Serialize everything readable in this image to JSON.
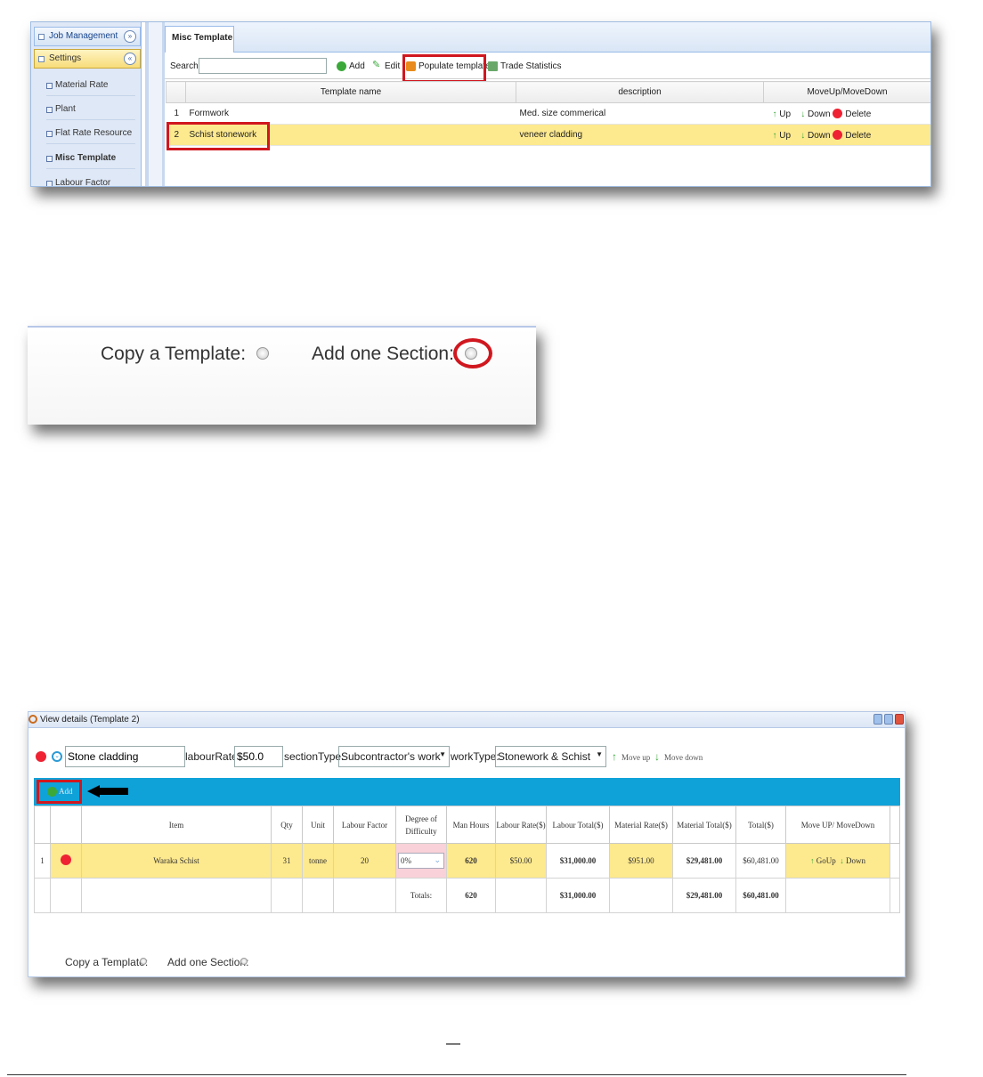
{
  "sidebar": {
    "job_management": "Job Management",
    "settings": "Settings",
    "items": [
      "Material Rate",
      "Plant",
      "Flat Rate Resource",
      "Misc Template",
      "Labour Factor"
    ]
  },
  "tab": {
    "label": "Misc Template"
  },
  "toolbar": {
    "search_label": "Search:",
    "search_value": "",
    "add": "Add",
    "edit": "Edit",
    "populate": "Populate template",
    "trade_stats": "Trade Statistics"
  },
  "grid1": {
    "headers": [
      "Template name",
      "description",
      "MoveUp/MoveDown"
    ],
    "rows": [
      {
        "num": "1",
        "name": "Formwork",
        "desc": "Med. size commerical",
        "up": "Up",
        "down": "Down",
        "del": "Delete"
      },
      {
        "num": "2",
        "name": "Schist stonework",
        "desc": "veneer cladding",
        "up": "Up",
        "down": "Down",
        "del": "Delete"
      }
    ]
  },
  "copy_big": "Copy a Template:",
  "add_big": "Add one Section:",
  "view": {
    "title": "View details (Template 2)",
    "section_name": "Stone cladding",
    "labour_label": "labourRate:",
    "labour_value": "$50.0",
    "section_type_label": "sectionType:",
    "section_type_value": "Subcontractor's work",
    "work_type_label": "workType:",
    "work_type_value": "Stonework & Schist",
    "move_up": "Move up",
    "move_down": "Move down",
    "add": "Add"
  },
  "grid3": {
    "headers": [
      "Item",
      "Qty",
      "Unit",
      "Labour Factor",
      "Degree of Difficulty",
      "Man Hours",
      "Labour Rate($)",
      "Labour Total($)",
      "Material Rate($)",
      "Material Total($)",
      "Total($)",
      "Move UP/ MoveDown"
    ],
    "row": {
      "num": "1",
      "item": "Waraka Schist",
      "qty": "31",
      "unit": "tonne",
      "factor": "20",
      "difficulty": "0%",
      "man_hours": "620",
      "labour_rate": "$50.00",
      "labour_total": "$31,000.00",
      "material_rate": "$951.00",
      "material_total": "$29,481.00",
      "total": "$60,481.00",
      "goup": "GoUp",
      "down": "Down"
    },
    "totals": {
      "label": "Totals:",
      "man_hours": "620",
      "labour_total": "$31,000.00",
      "material_total": "$29,481.00",
      "total": "$60,481.00"
    }
  },
  "copy_small": "Copy a Template:",
  "add_small": "Add one Section:",
  "footer_mark": "—",
  "colors": {
    "highlight": "#d0171f",
    "row_yellow": "#fde98e",
    "band_blue": "#0fa2d9"
  }
}
